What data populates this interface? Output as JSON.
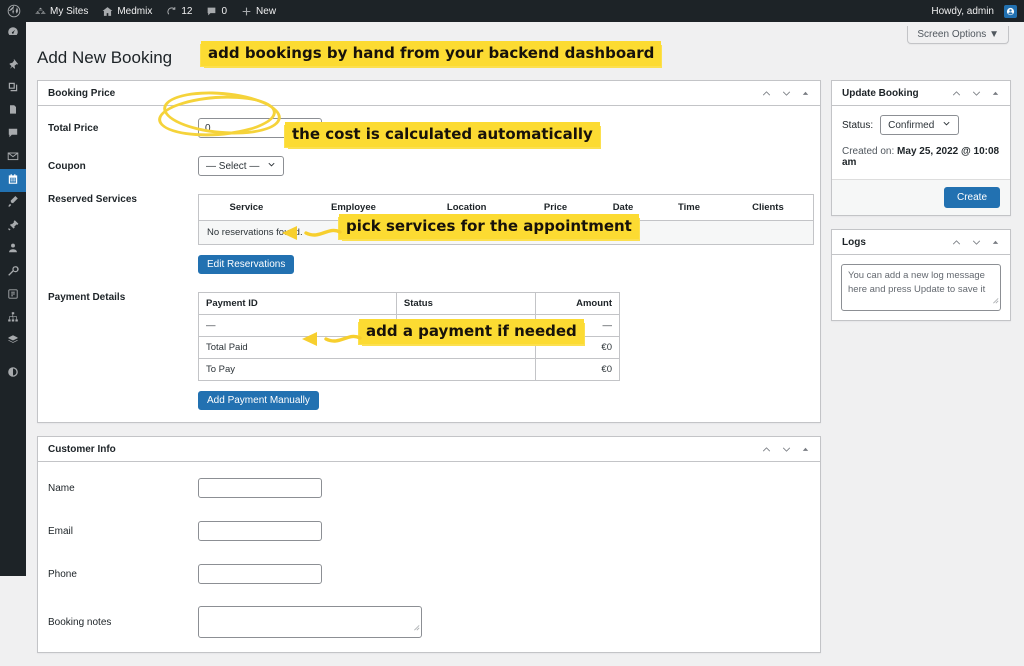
{
  "adminbar": {
    "logo_icon": "wordpress-icon",
    "my_sites": {
      "label": "My Sites",
      "icon": "sites-icon"
    },
    "site": {
      "label": "Medmix",
      "icon": "home-icon"
    },
    "updates": {
      "count": "12",
      "icon": "updates-icon"
    },
    "comments": {
      "count": "0",
      "icon": "comment-icon"
    },
    "new": {
      "label": "New",
      "icon": "plus-icon"
    },
    "howdy": "Howdy, admin",
    "avatar_icon": "user-avatar"
  },
  "adminmenu": {
    "items": [
      {
        "name": "dashboard",
        "icon": "dashboard-icon",
        "current": false
      },
      {
        "name": "posts",
        "icon": "pin-icon",
        "current": false
      },
      {
        "name": "media",
        "icon": "media-icon",
        "current": false
      },
      {
        "name": "pages",
        "icon": "pages-icon",
        "current": false
      },
      {
        "name": "comments",
        "icon": "comment-icon",
        "current": false
      },
      {
        "name": "mail",
        "icon": "mail-icon",
        "current": false
      },
      {
        "name": "bookings",
        "icon": "calendar-icon",
        "current": true
      },
      {
        "name": "appearance",
        "icon": "brush-icon",
        "current": false
      },
      {
        "name": "plugins",
        "icon": "plug-icon",
        "current": false
      },
      {
        "name": "users",
        "icon": "users-icon",
        "current": false
      },
      {
        "name": "tools",
        "icon": "wrench-icon",
        "current": false
      },
      {
        "name": "settings",
        "icon": "settings-icon",
        "current": false
      },
      {
        "name": "structure",
        "icon": "sitemap-icon",
        "current": false
      },
      {
        "name": "layers",
        "icon": "layers-icon",
        "current": false
      },
      {
        "name": "collapse",
        "icon": "collapse-icon",
        "current": false
      }
    ]
  },
  "screen_options": {
    "label": "Screen Options",
    "caret": "▼"
  },
  "page": {
    "title": "Add New Booking"
  },
  "booking_price": {
    "title": "Booking Price",
    "total_price": {
      "label": "Total Price",
      "value": "0"
    },
    "coupon": {
      "label": "Coupon",
      "value": "— Select —"
    },
    "reserved_services": {
      "label": "Reserved Services",
      "columns": [
        "Service",
        "Employee",
        "Location",
        "Price",
        "Date",
        "Time",
        "Clients"
      ],
      "empty_text": "No reservations found.",
      "button": "Edit Reservations"
    },
    "payment_details": {
      "label": "Payment Details",
      "columns": [
        "Payment ID",
        "Status",
        "Amount"
      ],
      "rows": [
        {
          "cells": [
            "—",
            "—",
            "—"
          ]
        }
      ],
      "summary": [
        {
          "label": "Total Paid",
          "amount": "€0"
        },
        {
          "label": "To Pay",
          "amount": "€0"
        }
      ],
      "button": "Add Payment Manually"
    }
  },
  "customer_info": {
    "title": "Customer Info",
    "fields": [
      {
        "label": "Name",
        "value": ""
      },
      {
        "label": "Email",
        "value": ""
      },
      {
        "label": "Phone",
        "value": ""
      }
    ],
    "notes": {
      "label": "Booking notes",
      "value": ""
    }
  },
  "update_booking": {
    "title": "Update Booking",
    "status_label": "Status:",
    "status_value": "Confirmed",
    "created_label": "Created on:",
    "created_value": "May 25, 2022 @ 10:08 am",
    "submit": "Create"
  },
  "logs": {
    "title": "Logs",
    "placeholder": "You can add a new log message here and press Update to save it"
  },
  "annotations": [
    {
      "text": "add bookings by hand from your backend dashboard"
    },
    {
      "text": "the cost is calculated automatically"
    },
    {
      "text": "pick services for the appointment"
    },
    {
      "text": "add a payment if needed"
    }
  ],
  "colors": {
    "admin_dark": "#1d2327",
    "accent_blue": "#2271b1",
    "highlight_yellow": "#fcdb32",
    "page_bg": "#f0f0f1"
  }
}
